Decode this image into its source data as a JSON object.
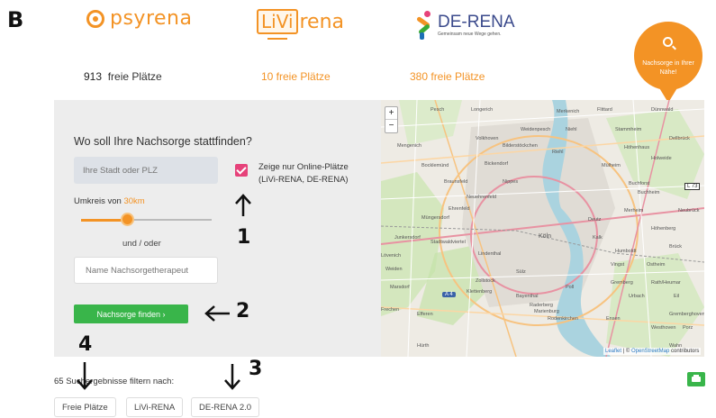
{
  "panel_letter": "B",
  "logos": {
    "psyrena": "psyrena",
    "livi_box": "LiVi",
    "livi_rest": "rena",
    "derena_name": "DE-RENA",
    "derena_tagline": "Gemeinsam neue Wege gehen."
  },
  "free_places": {
    "psyrena_count": "913",
    "psyrena_label": "freie Plätze",
    "livi": "10  freie Plätze",
    "derena": "380  freie Plätze"
  },
  "search_badge": {
    "icon": "search-icon",
    "text": "Nachsorge in Ihrer Nähe!"
  },
  "form": {
    "question": "Wo soll Ihre Nachsorge stattfinden?",
    "city_placeholder": "Ihre Stadt oder PLZ",
    "online_checkbox_checked": true,
    "online_label_line1": "Zeige nur Online-Plätze",
    "online_label_line2": "(LiVi-RENA, DE-RENA)",
    "radius_label": "Umkreis von ",
    "radius_value": "30km",
    "slider_fraction": 0.35,
    "and_or": "und / oder",
    "therapist_placeholder": "Name Nachsorgetherapeut",
    "find_button": "Nachsorge finden  ›"
  },
  "map": {
    "zoom_in": "+",
    "zoom_out": "−",
    "attribution_leaflet": "Leaflet",
    "attribution_sep": " | © ",
    "attribution_osm": "OpenStreetMap",
    "attribution_rest": " contributors",
    "labels": [
      "Longerich",
      "Mengenich",
      "Bickendorf",
      "Nippes",
      "Köln",
      "Lindenthal",
      "Sülz",
      "Rodenkirchen",
      "Kalk",
      "Poll",
      "Stammheim",
      "Holweide",
      "Dellbrück",
      "Merheim",
      "Brück",
      "Rath/Heumar",
      "Eil",
      "Porz",
      "Müngersdorf",
      "Junkersdorf",
      "Braunsfeld",
      "Ehrenfeld",
      "Weiden",
      "Marsdorf",
      "Efferen",
      "Hürth",
      "Buchforst",
      "Höhenberg",
      "Humboldt",
      "Bayenthal",
      "Zollstock",
      "Raderberg",
      "Marienburg",
      "Westhoven",
      "Ensen",
      "Niehl",
      "Weidenpesch",
      "Pesch",
      "Flittard",
      "Dünnwald",
      "Höhenhaus",
      "Mülheim",
      "Buchheim",
      "Vingst",
      "Ostheim",
      "Gremberghoven",
      "Urbach",
      "Neubrück",
      "Lövenich",
      "Frechen",
      "Stadtwaldviertel",
      "Klettenberg",
      "Bocklemünd",
      "Volkhoven",
      "Merkenich",
      "Riehl",
      "Bilderstöckchen",
      "Deutz",
      "Neuehrenfeld",
      "Gremberg",
      "Wahn"
    ],
    "shields": [
      "A 4",
      "L 73"
    ]
  },
  "results": {
    "count": "65",
    "text_suffix": " Suchergebnisse filtern nach:"
  },
  "filters": [
    "Freie Plätze",
    "LiVi-RENA",
    "DE-RENA 2.0"
  ],
  "print_icon": "printer-icon",
  "annotations": [
    "1",
    "2",
    "3",
    "4"
  ],
  "colors": {
    "accent_orange": "#f39325",
    "checkbox_pink": "#e6427a",
    "button_green": "#39b54a",
    "panel_grey": "#ededed"
  }
}
